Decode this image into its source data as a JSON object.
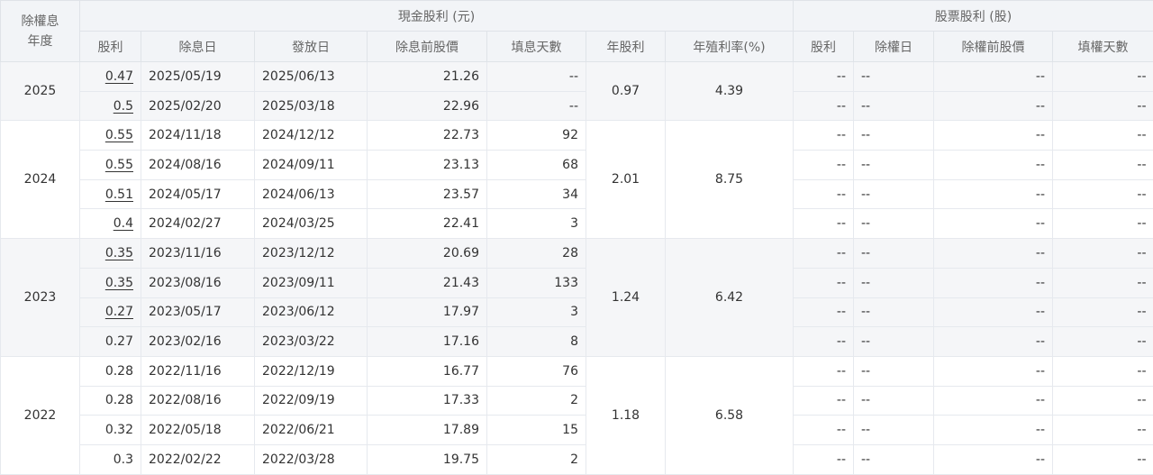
{
  "header": {
    "year_col": "除權息\n年度",
    "cash_group": "現金股利 (元)",
    "stock_group": "股票股利 (股)",
    "cash_cols": [
      "股利",
      "除息日",
      "發放日",
      "除息前股價",
      "填息天數"
    ],
    "annual_div": "年股利",
    "annual_yield": "年殖利率(%)",
    "stock_cols": [
      "股利",
      "除權日",
      "除權前股價",
      "填權天數"
    ]
  },
  "groups": [
    {
      "year": "2025",
      "annual_dividend": "0.97",
      "annual_yield": "4.39",
      "rows": [
        {
          "dividend": "0.47",
          "link": true,
          "ex_date": "2025/05/19",
          "pay_date": "2025/06/13",
          "pre_price": "21.26",
          "fill_days": "--",
          "s_div": "--",
          "s_date": "--",
          "s_price": "--",
          "s_fill": "--"
        },
        {
          "dividend": "0.5",
          "link": true,
          "ex_date": "2025/02/20",
          "pay_date": "2025/03/18",
          "pre_price": "22.96",
          "fill_days": "--",
          "s_div": "--",
          "s_date": "--",
          "s_price": "--",
          "s_fill": "--"
        }
      ]
    },
    {
      "year": "2024",
      "annual_dividend": "2.01",
      "annual_yield": "8.75",
      "rows": [
        {
          "dividend": "0.55",
          "link": true,
          "ex_date": "2024/11/18",
          "pay_date": "2024/12/12",
          "pre_price": "22.73",
          "fill_days": "92",
          "s_div": "--",
          "s_date": "--",
          "s_price": "--",
          "s_fill": "--"
        },
        {
          "dividend": "0.55",
          "link": true,
          "ex_date": "2024/08/16",
          "pay_date": "2024/09/11",
          "pre_price": "23.13",
          "fill_days": "68",
          "s_div": "--",
          "s_date": "--",
          "s_price": "--",
          "s_fill": "--"
        },
        {
          "dividend": "0.51",
          "link": true,
          "ex_date": "2024/05/17",
          "pay_date": "2024/06/13",
          "pre_price": "23.57",
          "fill_days": "34",
          "s_div": "--",
          "s_date": "--",
          "s_price": "--",
          "s_fill": "--"
        },
        {
          "dividend": "0.4",
          "link": true,
          "ex_date": "2024/02/27",
          "pay_date": "2024/03/25",
          "pre_price": "22.41",
          "fill_days": "3",
          "s_div": "--",
          "s_date": "--",
          "s_price": "--",
          "s_fill": "--"
        }
      ]
    },
    {
      "year": "2023",
      "annual_dividend": "1.24",
      "annual_yield": "6.42",
      "rows": [
        {
          "dividend": "0.35",
          "link": true,
          "ex_date": "2023/11/16",
          "pay_date": "2023/12/12",
          "pre_price": "20.69",
          "fill_days": "28",
          "s_div": "--",
          "s_date": "--",
          "s_price": "--",
          "s_fill": "--"
        },
        {
          "dividend": "0.35",
          "link": true,
          "ex_date": "2023/08/16",
          "pay_date": "2023/09/11",
          "pre_price": "21.43",
          "fill_days": "133",
          "s_div": "--",
          "s_date": "--",
          "s_price": "--",
          "s_fill": "--"
        },
        {
          "dividend": "0.27",
          "link": true,
          "ex_date": "2023/05/17",
          "pay_date": "2023/06/12",
          "pre_price": "17.97",
          "fill_days": "3",
          "s_div": "--",
          "s_date": "--",
          "s_price": "--",
          "s_fill": "--"
        },
        {
          "dividend": "0.27",
          "link": false,
          "ex_date": "2023/02/16",
          "pay_date": "2023/03/22",
          "pre_price": "17.16",
          "fill_days": "8",
          "s_div": "--",
          "s_date": "--",
          "s_price": "--",
          "s_fill": "--"
        }
      ]
    },
    {
      "year": "2022",
      "annual_dividend": "1.18",
      "annual_yield": "6.58",
      "rows": [
        {
          "dividend": "0.28",
          "link": false,
          "ex_date": "2022/11/16",
          "pay_date": "2022/12/19",
          "pre_price": "16.77",
          "fill_days": "76",
          "s_div": "--",
          "s_date": "--",
          "s_price": "--",
          "s_fill": "--"
        },
        {
          "dividend": "0.28",
          "link": false,
          "ex_date": "2022/08/16",
          "pay_date": "2022/09/19",
          "pre_price": "17.33",
          "fill_days": "2",
          "s_div": "--",
          "s_date": "--",
          "s_price": "--",
          "s_fill": "--"
        },
        {
          "dividend": "0.32",
          "link": false,
          "ex_date": "2022/05/18",
          "pay_date": "2022/06/21",
          "pre_price": "17.89",
          "fill_days": "15",
          "s_div": "--",
          "s_date": "--",
          "s_price": "--",
          "s_fill": "--"
        },
        {
          "dividend": "0.3",
          "link": false,
          "ex_date": "2022/02/22",
          "pay_date": "2022/03/28",
          "pre_price": "19.75",
          "fill_days": "2",
          "s_div": "--",
          "s_date": "--",
          "s_price": "--",
          "s_fill": "--"
        }
      ]
    }
  ],
  "colors": {
    "header_bg": "#f2f4f7",
    "alt_group_bg": "#f5f6f8",
    "border": "#dfe3e8",
    "text": "#333333",
    "header_text": "#666666"
  }
}
